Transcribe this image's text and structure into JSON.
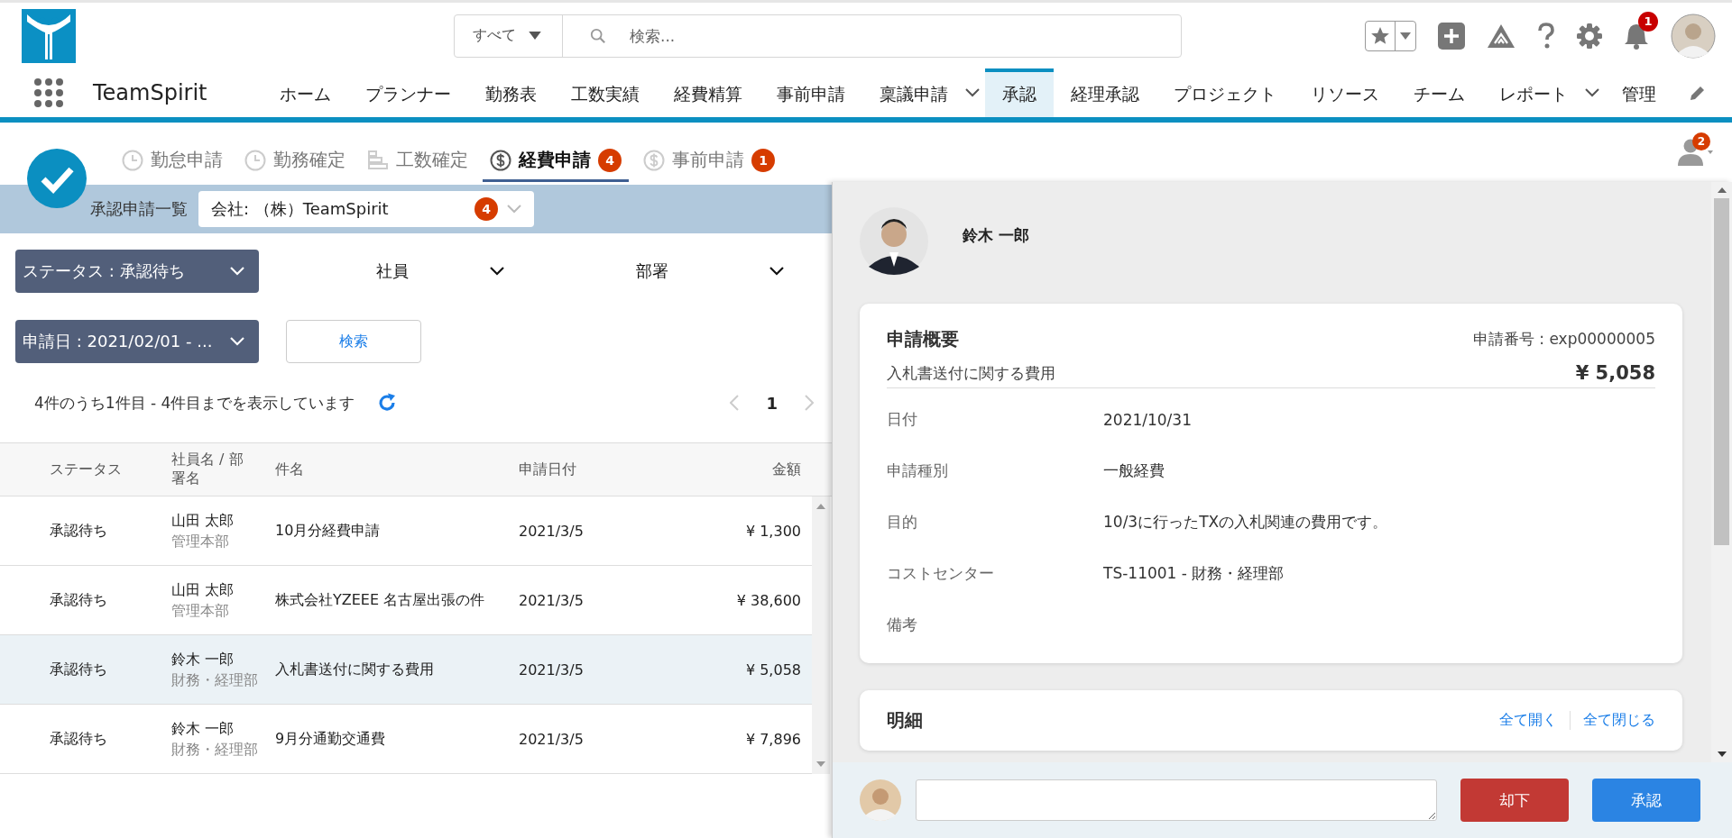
{
  "header": {
    "search": {
      "scope": "すべて",
      "placeholder": "検索..."
    },
    "notification_badge": "1"
  },
  "nav": {
    "app_name": "TeamSpirit",
    "items": [
      {
        "label": "ホーム",
        "selected": false,
        "has_menu": false
      },
      {
        "label": "プランナー",
        "selected": false,
        "has_menu": false
      },
      {
        "label": "勤務表",
        "selected": false,
        "has_menu": false
      },
      {
        "label": "工数実績",
        "selected": false,
        "has_menu": false
      },
      {
        "label": "経費精算",
        "selected": false,
        "has_menu": false
      },
      {
        "label": "事前申請",
        "selected": false,
        "has_menu": false
      },
      {
        "label": "稟議申請",
        "selected": false,
        "has_menu": true
      },
      {
        "label": "承認",
        "selected": true,
        "has_menu": false
      },
      {
        "label": "経理承認",
        "selected": false,
        "has_menu": false
      },
      {
        "label": "プロジェクト",
        "selected": false,
        "has_menu": false
      },
      {
        "label": "リソース",
        "selected": false,
        "has_menu": false
      },
      {
        "label": "チーム",
        "selected": false,
        "has_menu": false
      },
      {
        "label": "レポート",
        "selected": false,
        "has_menu": true
      },
      {
        "label": "管理",
        "selected": false,
        "has_menu": false
      }
    ]
  },
  "tabs": [
    {
      "label": "勤怠申請",
      "kind": "clock",
      "selected": false
    },
    {
      "label": "勤務確定",
      "kind": "clock",
      "selected": false
    },
    {
      "label": "工数確定",
      "kind": "bars",
      "selected": false
    },
    {
      "label": "経費申請",
      "kind": "money",
      "selected": true,
      "badge": "4"
    },
    {
      "label": "事前申請",
      "kind": "money",
      "selected": false,
      "badge": "1"
    }
  ],
  "user_badge": "2",
  "list": {
    "title": "承認申請一覧",
    "company": {
      "value": "会社: （株）TeamSpirit",
      "badge": "4"
    },
    "filters": [
      {
        "label": "ステータス : 承認待ち",
        "kind": "dark"
      },
      {
        "label": "社員",
        "kind": "plain"
      },
      {
        "label": "部署",
        "kind": "plain"
      },
      {
        "label": "申請日 : 2021/02/01 - ...",
        "kind": "dark"
      }
    ],
    "search_button": "検索",
    "summary": "4件のうち1件目 - 4件目までを表示しています",
    "page": "1"
  },
  "table": {
    "columns": [
      "ステータス",
      "社員名 / 部署名",
      "件名",
      "申請日付",
      "金額"
    ],
    "rows": [
      {
        "status": "承認待ち",
        "name": "山田 太郎",
        "department": "管理本部",
        "subject": "10月分経費申請",
        "date": "2021/3/5",
        "amount": "¥ 1,300",
        "selected": false
      },
      {
        "status": "承認待ち",
        "name": "山田 太郎",
        "department": "管理本部",
        "subject": "株式会社YZEEE 名古屋出張の件",
        "date": "2021/3/5",
        "amount": "¥ 38,600",
        "selected": false
      },
      {
        "status": "承認待ち",
        "name": "鈴木 一郎",
        "department": "財務・経理部",
        "subject": "入札書送付に関する費用",
        "date": "2021/3/5",
        "amount": "¥ 5,058",
        "selected": true
      },
      {
        "status": "承認待ち",
        "name": "鈴木 一郎",
        "department": "財務・経理部",
        "subject": "9月分通勤交通費",
        "date": "2021/3/5",
        "amount": "¥ 7,896",
        "selected": false
      }
    ]
  },
  "detail": {
    "applicant": "鈴木 一郎",
    "summary": {
      "title": "申請概要",
      "number": "申請番号 : exp00000005",
      "subject": "入札書送付に関する費用",
      "amount": "¥ 5,058",
      "fields": [
        {
          "label": "日付",
          "value": "2021/10/31"
        },
        {
          "label": "申請種別",
          "value": "一般経費"
        },
        {
          "label": "目的",
          "value": "10/3に行ったTXの入札関連の費用です。"
        },
        {
          "label": "コストセンター",
          "value": "TS-11001 - 財務・経理部"
        },
        {
          "label": "備考"
        }
      ]
    },
    "items": {
      "title": "明細",
      "links": [
        "全て開く",
        "全て閉じる"
      ]
    },
    "footer": {
      "reject": "却下",
      "approve": "承認"
    }
  }
}
